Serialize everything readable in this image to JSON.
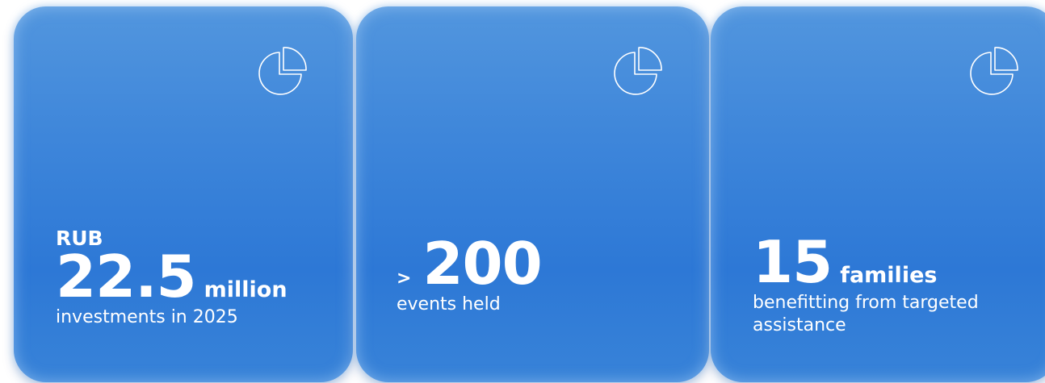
{
  "cards": [
    {
      "icon": "pie-chart-icon",
      "prefix": "RUB",
      "value": "22.5",
      "unit": "million",
      "description": "investments in 2025"
    },
    {
      "icon": "pie-chart-icon",
      "prefix": ">",
      "value": "200",
      "unit": "",
      "description": "events held"
    },
    {
      "icon": "pie-chart-icon",
      "prefix": "",
      "value": "15",
      "unit": "families",
      "description": "benefitting from targeted assistance"
    }
  ],
  "colors": {
    "card_top": "#5296de",
    "card_bottom": "#2d78d6",
    "text": "#ffffff"
  }
}
